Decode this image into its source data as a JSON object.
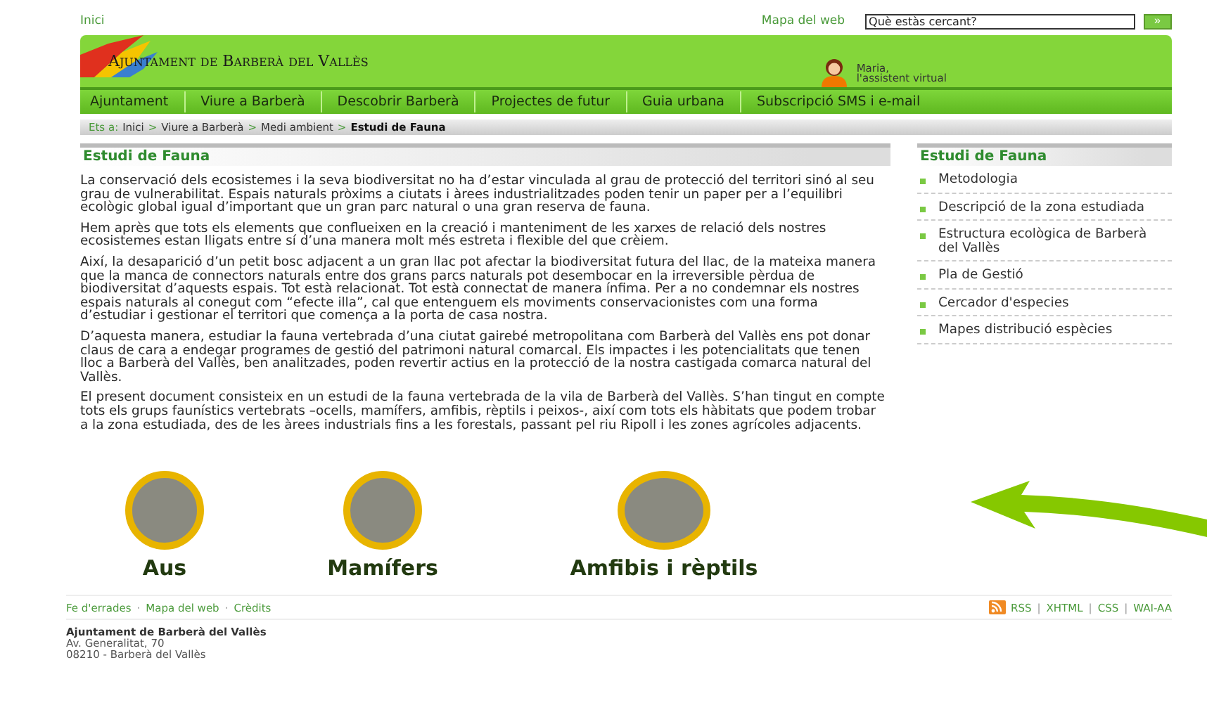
{
  "top_bar": {
    "home_link": "Inici",
    "sitemap_link": "Mapa del web",
    "search": {
      "placeholder": "Què estàs cercant?",
      "button": "»"
    }
  },
  "header": {
    "site_name": "Ajuntament de Barberà del Vallès",
    "assistant": {
      "name": "Maria,",
      "role": "l'assistent virtual"
    }
  },
  "nav": [
    "Ajuntament",
    "Viure a Barberà",
    "Descobrir Barberà",
    "Projectes de futur",
    "Guia urbana",
    "Subscripció SMS i e-mail"
  ],
  "breadcrumb": {
    "prefix": "Ets a:",
    "items": [
      "Inici",
      "Viure a Barberà",
      "Medi ambient"
    ],
    "current": "Estudi de Fauna",
    "separator": ">"
  },
  "main": {
    "title": "Estudi de Fauna",
    "paragraphs": [
      "La conservació dels ecosistemes i la seva biodiversitat no ha d’estar vinculada al grau de protecció del territori sinó al seu grau de vulnerabilitat. Espais naturals pròxims a ciutats i àrees industrialitzades poden tenir un paper per a l’equilibri ecològic global igual d’important que un gran parc natural o una gran reserva de fauna.",
      "Hem après que tots els elements que conflueixen en la creació i manteniment de les xarxes de relació dels nostres ecosistemes estan lligats entre sí d’una manera molt més estreta i flexible del que crèiem.",
      "Així, la desaparició d’un petit bosc adjacent a un gran llac pot afectar la biodiversitat futura del llac, de la mateixa manera que la manca de connectors naturals entre dos grans parcs naturals pot desembocar en la irreversible pèrdua de biodiversitat d’aquests espais. Tot està relacionat. Tot està connectat de manera ínfima. Per a no condemnar els nostres espais naturals al conegut com “efecte illa”, cal que entenguem els moviments conservacionistes com una forma d’estudiar i gestionar el territori que comença a la porta de casa nostra.",
      "D’aquesta manera, estudiar la fauna vertebrada d’una ciutat gairebé metropolitana com Barberà del Vallès ens pot donar claus de cara a endegar programes de gestió del patrimoni natural comarcal. Els impactes i les potencialitats que tenen lloc a Barberà del Vallès, ben analitzades, poden revertir actius en la protecció de la nostra castigada comarca natural del Vallès.",
      "El present document consisteix en un estudi de la fauna vertebrada de la vila de Barberà del Vallès. S’han tingut en compte tots els grups faunístics vertebrats –ocells, mamífers, amfibis, rèptils i peixos-, així com tots els hàbitats que podem trobar a la zona estudiada, des de les àrees industrials fins a les forestals, passant pel riu Ripoll i les zones agrícoles adjacents."
    ]
  },
  "categories": [
    {
      "label": "Aus"
    },
    {
      "label": "Mamífers"
    },
    {
      "label": "Amfibis i rèptils"
    }
  ],
  "sidebar": {
    "title": "Estudi de Fauna",
    "items": [
      "Metodologia",
      "Descripció de la zona estudiada",
      "Estructura ecològica de Barberà del Vallès",
      "Pla de Gestió",
      "Cercador d'especies",
      "Mapes distribució espècies"
    ]
  },
  "footer": {
    "links": [
      "Fe d'errades",
      "Mapa del web",
      "Crèdits"
    ],
    "link_separator": "·",
    "formats": [
      "RSS",
      "XHTML",
      "CSS",
      "WAI-AA"
    ],
    "format_separator": "|",
    "address": {
      "name": "Ajuntament de Barberà del Vallès",
      "lines": [
        "Av. Generalitat, 70",
        "08210 - Barberà del Vallès"
      ]
    }
  }
}
